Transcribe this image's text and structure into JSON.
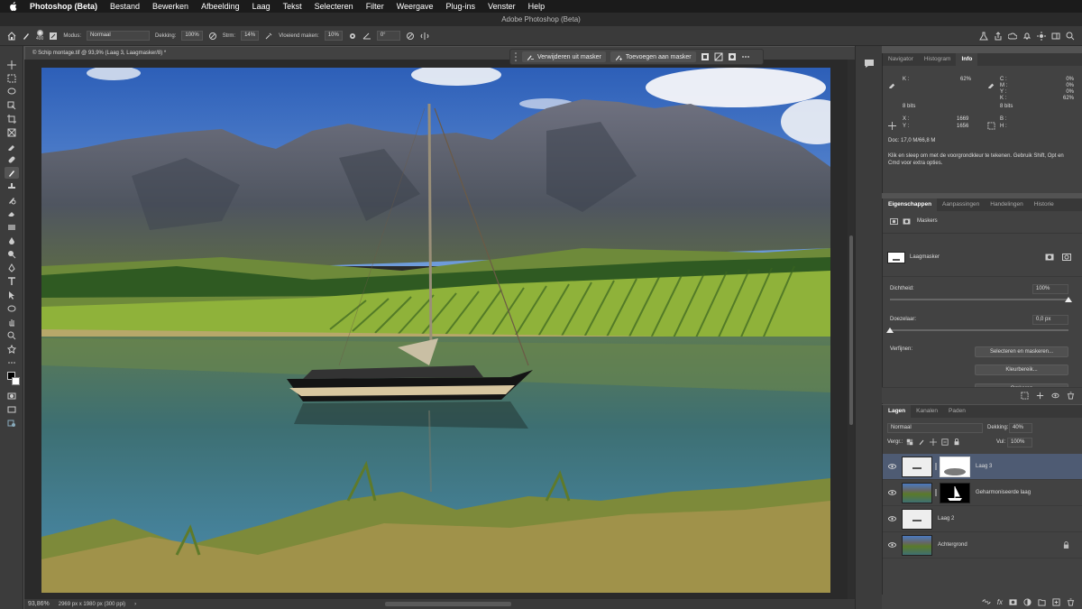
{
  "menubar": {
    "app_name": "Photoshop (Beta)",
    "items": [
      "Bestand",
      "Bewerken",
      "Afbeelding",
      "Laag",
      "Tekst",
      "Selecteren",
      "Filter",
      "Weergave",
      "Plug-ins",
      "Venster",
      "Help"
    ]
  },
  "window_title": "Adobe Photoshop (Beta)",
  "options": {
    "brush_size": "400",
    "mode_label": "Modus:",
    "mode_value": "Normaal",
    "opacity_label": "Dekking:",
    "opacity_value": "100%",
    "flow_label": "Strm:",
    "flow_value": "14%",
    "smoothing_label": "Vloeiend maken:",
    "smoothing_value": "10%",
    "angle_value": "0°"
  },
  "document_tab": "© Schip montage.tif @ 93,9% (Laag 3, Laagmasker/8) *",
  "mask_bar": {
    "remove_label": "Verwijderen uit masker",
    "add_label": "Toevoegen aan masker"
  },
  "statusbar": {
    "zoom": "93,86%",
    "doc_info": "2969 px x 1980 px (300 ppi)"
  },
  "info_panel": {
    "tabs": [
      "Navigator",
      "Histogram",
      "Info"
    ],
    "k_label": "K :",
    "k_value": "62%",
    "bits_left": "8 bits",
    "cmyk_labels": [
      "C :",
      "M :",
      "Y :",
      "K :"
    ],
    "cmyk_values": [
      "0%",
      "0%",
      "0%",
      "62%"
    ],
    "bits_right": "8 bits",
    "x_label": "X :",
    "x_value": "1669",
    "y_label": "Y :",
    "y_value": "1656",
    "b_label": "B :",
    "h_label": "H :",
    "doc": "Doc: 17,0 M/66,8 M",
    "hint": "Klik en sleep om met de voorgrondkleur te tekenen. Gebruik Shift, Opt en Cmd voor extra opties."
  },
  "properties_panel": {
    "tabs": [
      "Eigenschappen",
      "Aanpassingen",
      "Handelingen",
      "Historie"
    ],
    "masks_label": "Maskers",
    "mask_name": "Laagmasker",
    "density_label": "Dichtheid:",
    "density_value": "100%",
    "density_level": 1.0,
    "feather_label": "Doezelaar:",
    "feather_value": "0,0 px",
    "feather_level": 0.0,
    "refine_label": "Verfijnen:",
    "select_mask_button": "Selecteren en maskeren...",
    "color_range_button": "Kleurbereik...",
    "invert_button": "Omkeren"
  },
  "layers_panel": {
    "tabs": [
      "Lagen",
      "Kanalen",
      "Paden"
    ],
    "blend_mode": "Normaal",
    "opacity_label": "Dekking:",
    "opacity_value": "40%",
    "lock_label": "Vergr.:",
    "fill_label": "Vul:",
    "fill_value": "100%",
    "layers": [
      {
        "name": "Laag 3",
        "selected": true
      },
      {
        "name": "Geharmoniseerde laag",
        "selected": false
      },
      {
        "name": "Laag 2",
        "selected": false
      },
      {
        "name": "Achtergrond",
        "selected": false
      }
    ],
    "fx_label": "fx"
  },
  "colors": {
    "menubar_bg": "#1b1b1b",
    "panel_bg": "#424242",
    "selection_blue": "#4e5b73",
    "canvas_bg": "#2a2a2a"
  }
}
